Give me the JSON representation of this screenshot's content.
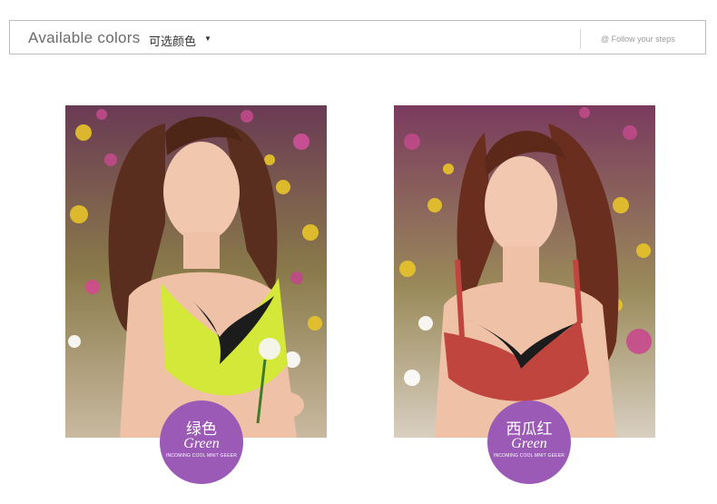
{
  "header": {
    "title": "Available colors",
    "subtitle": "可选颜色",
    "caret": "▼",
    "follow": "@ Follow your steps"
  },
  "products": [
    {
      "color_cn": "绿色",
      "color_en": "Green",
      "tagline": "INCOMING COOL MNIT GEEER",
      "accent": "#d4e83a"
    },
    {
      "color_cn": "西瓜红",
      "color_en": "Green",
      "tagline": "INCOMING COOL MNIT GEEER",
      "accent": "#c0453f"
    }
  ],
  "colors": {
    "badge": "#9b5ab6",
    "border": "#bdbdbd"
  }
}
